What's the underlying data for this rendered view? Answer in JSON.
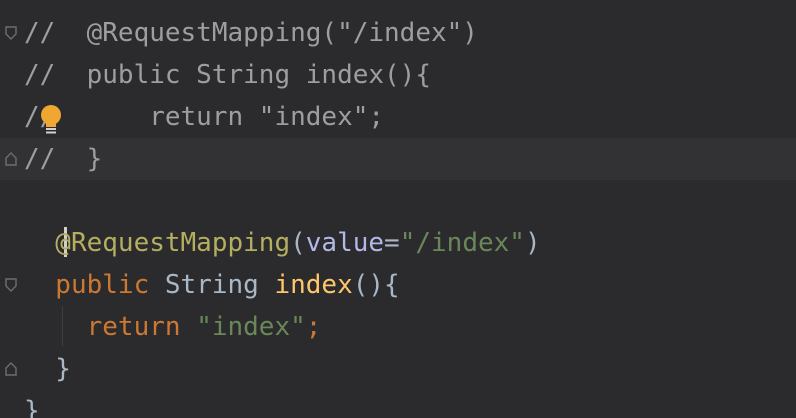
{
  "editor": {
    "lines": [
      {
        "segments": [
          {
            "t": "//  @RequestMapping(\"/index\")",
            "c": "c-comment"
          }
        ]
      },
      {
        "segments": [
          {
            "t": "//  public String index(){",
            "c": "c-comment"
          }
        ]
      },
      {
        "segments": [
          {
            "t": "//      return \"index\";",
            "c": "c-comment"
          }
        ]
      },
      {
        "segments": [
          {
            "t": "//  }",
            "c": "c-comment"
          }
        ]
      },
      {
        "segments": []
      },
      {
        "segments": [
          {
            "t": "  @RequestMapping",
            "c": "c-annot"
          },
          {
            "t": "(",
            "c": "c-plain"
          },
          {
            "t": "value",
            "c": "c-param"
          },
          {
            "t": "=",
            "c": "c-plain"
          },
          {
            "t": "\"/index\"",
            "c": "c-string"
          },
          {
            "t": ")",
            "c": "c-plain"
          }
        ]
      },
      {
        "segments": [
          {
            "t": "  public ",
            "c": "c-keyword"
          },
          {
            "t": "String ",
            "c": "c-plain"
          },
          {
            "t": "index",
            "c": "c-func"
          },
          {
            "t": "(){",
            "c": "c-plain"
          }
        ]
      },
      {
        "segments": [
          {
            "t": "    return ",
            "c": "c-keyword"
          },
          {
            "t": "\"index\"",
            "c": "c-string"
          },
          {
            "t": ";",
            "c": "c-keyword"
          }
        ]
      },
      {
        "segments": [
          {
            "t": "  }",
            "c": "c-plain"
          }
        ]
      },
      {
        "segments": [
          {
            "t": "}",
            "c": "c-plain"
          }
        ]
      }
    ],
    "icons": {
      "intention": "lightbulb-icon",
      "fold": "fold-marker-icon"
    },
    "colors": {
      "background": "#2b2b2d",
      "comment": "#9d9ea2",
      "annotation": "#b3ae60",
      "keyword": "#cc7832",
      "string": "#6a8759",
      "method": "#ffc66d",
      "parameter": "#b4b8e8",
      "bulb": "#f0a732"
    }
  }
}
